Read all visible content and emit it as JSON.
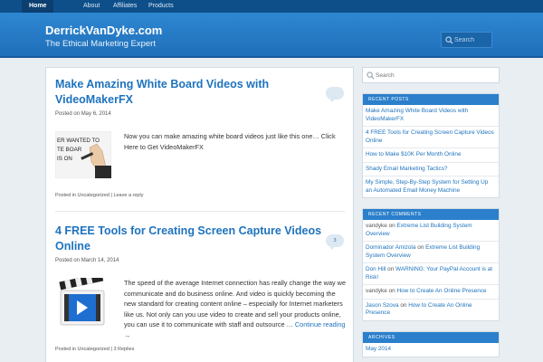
{
  "nav": {
    "items": [
      {
        "label": "Home",
        "active": true
      },
      {
        "label": "About",
        "active": false
      },
      {
        "label": "Affiliates",
        "active": false
      },
      {
        "label": "Products",
        "active": false
      }
    ]
  },
  "header": {
    "title": "DerrickVanDyke.com",
    "description": "The Ethical Marketing Expert",
    "search_placeholder": "Search"
  },
  "posts": [
    {
      "title": "Make Amazing White Board Videos with VideoMakerFX",
      "date_prefix": "Posted on ",
      "date": "May 6, 2014",
      "comment_count": "",
      "thumb_icon": "whiteboard-video-thumbnail",
      "thumb_text": "ER WANTED TO TE BOAR IS ON",
      "excerpt": "Now you can make amazing white board videos just like this one… Click Here to Get VideoMakerFX",
      "meta_prefix": "Posted in ",
      "category": "Uncategorized",
      "meta_sep": " | ",
      "comments_link": "Leave a reply"
    },
    {
      "title": "4 FREE Tools for Creating Screen Capture Videos Online",
      "date_prefix": "Posted on ",
      "date": "March 14, 2014",
      "comment_count": "3",
      "thumb_icon": "clapperboard-video-icon",
      "excerpt": "The speed of the average Internet connection has really change the way we communicate and do business online. And video is quickly becoming the new standard for creating content online – especially for Internet marketers like us. Not only can you use video to create and sell your products online, you can use it to communicate with staff and outsource … ",
      "read_more": "Continue reading →",
      "meta_prefix": "Posted in ",
      "category": "Uncategorized",
      "meta_sep": " | ",
      "comments_link": "3 Replies"
    }
  ],
  "sidebar": {
    "search_placeholder": "Search",
    "recent_posts": {
      "title": "Recent Posts",
      "items": [
        "Make Amazing White Board Videos with VideoMakerFX",
        "4 FREE Tools for Creating Screen Capture Videos Online",
        "How to Make $10K Per Month Online",
        "Shady Email Marketing Tactics?",
        "My Simple, Step-By-Step System for Setting Up an Automated Email Money Machine"
      ]
    },
    "recent_comments": {
      "title": "Recent Comments",
      "items": [
        {
          "author": "vandyke",
          "author_link": false,
          "on": " on ",
          "post": "Extreme List Building System Overview"
        },
        {
          "author": "Dominador Amizola",
          "author_link": true,
          "on": " on ",
          "post": "Extreme List Building System Overview"
        },
        {
          "author": "Don Hill",
          "author_link": true,
          "on": " on ",
          "post": "WARNING: Your PayPal Account is at Risk!"
        },
        {
          "author": "vandyke",
          "author_link": false,
          "on": " on ",
          "post": "How to Create An Online Presence"
        },
        {
          "author": "Jason Szova",
          "author_link": true,
          "on": " on ",
          "post": "How to Create An Online Presence"
        }
      ]
    },
    "archives": {
      "title": "Archives",
      "items": [
        "May 2014"
      ]
    }
  },
  "colors": {
    "nav_bg": "#0e4f8a",
    "header_bg": "#2479c5",
    "link": "#1e73be",
    "widget_title_bg": "#2b7fcb",
    "page_bg": "#e9eef2"
  }
}
